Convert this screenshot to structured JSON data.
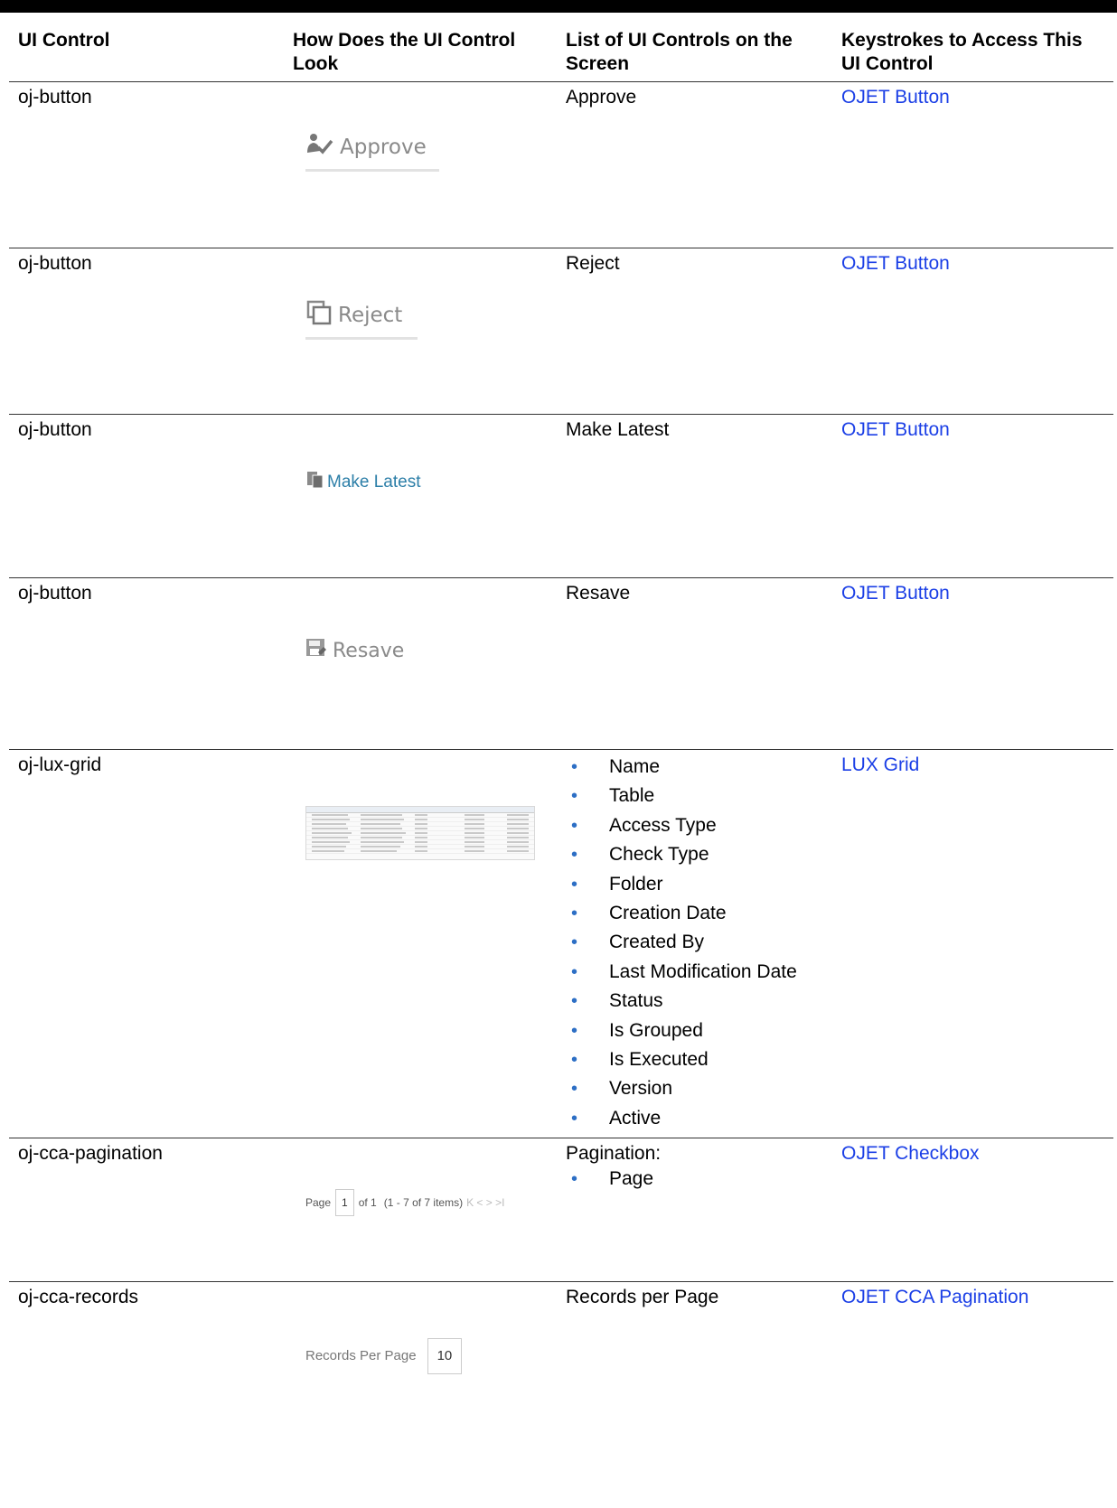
{
  "table": {
    "headers": [
      "UI Control",
      "How Does the UI Control Look",
      "List of UI Controls on the Screen",
      "Keystrokes to Access This UI Control"
    ],
    "rows": [
      {
        "control": "oj-button",
        "look_text": "Approve",
        "list_text": "Approve",
        "link": "OJET Button"
      },
      {
        "control": "oj-button",
        "look_text": "Reject",
        "list_text": "Reject",
        "link": "OJET Button"
      },
      {
        "control": "oj-button",
        "look_text": "Make Latest",
        "list_text": "Make Latest",
        "link": "OJET Button"
      },
      {
        "control": "oj-button",
        "look_text": "Resave",
        "list_text": "Resave",
        "link": "OJET Button"
      },
      {
        "control": "oj-lux-grid",
        "list_items": [
          "Name",
          "Table",
          "Access Type",
          "Check Type",
          "Folder",
          "Creation Date",
          "Created By",
          "Last Modification Date",
          "Status",
          "Is Grouped",
          "Is Executed",
          "Version",
          "Active"
        ],
        "link": "LUX Grid"
      },
      {
        "control": "oj-cca-pagination",
        "list_text": "Pagination:",
        "list_items": [
          "Page"
        ],
        "link": "OJET Checkbox",
        "pager": {
          "page_label": "Page",
          "page_value": "1",
          "of_label": "of 1",
          "items_label": "(1 - 7 of  7  items)",
          "nav": "K < > >I"
        }
      },
      {
        "control": "oj-cca-records",
        "list_text": "Records per Page",
        "link": "OJET CCA Pagination",
        "records": {
          "label": "Records Per Page",
          "value": "10"
        }
      }
    ]
  },
  "icons": {
    "approve": "user-check-icon",
    "reject": "copy-icon",
    "make_latest": "documents-icon",
    "resave": "save-icon"
  },
  "colors": {
    "link": "#1b3fe6",
    "bullet": "#2d6fc5"
  }
}
